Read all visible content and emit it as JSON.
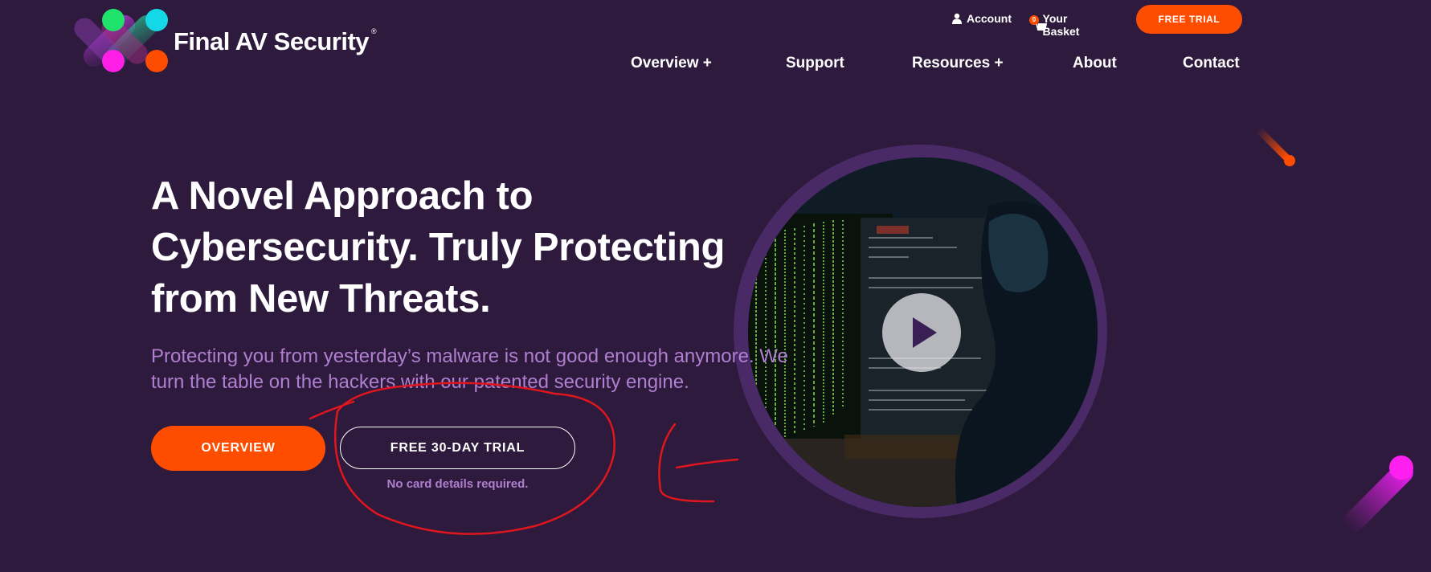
{
  "brand": {
    "name": "Final AV Security",
    "reg_mark": "®"
  },
  "utility": {
    "account_label": "Account",
    "basket_label": "Your Basket",
    "basket_count": "0",
    "cta_label": "FREE TRIAL"
  },
  "nav": {
    "items": [
      {
        "label": "Overview +"
      },
      {
        "label": "Support"
      },
      {
        "label": "Resources +"
      },
      {
        "label": "About"
      },
      {
        "label": "Contact"
      }
    ]
  },
  "hero": {
    "title_lines": [
      "A Novel Approach to",
      "Cybersecurity. Truly Protecting",
      "from New Threats."
    ],
    "subtitle_lines": [
      "Protecting you from yesterday’s malware is not good enough anymore. We",
      "turn the table on the hackers with our patented security engine."
    ],
    "primary_button": "OVERVIEW",
    "secondary_button": "FREE 30-DAY TRIAL",
    "note": "No card details required."
  },
  "video": {
    "play_icon": "play-icon"
  },
  "colors": {
    "background": "#2e1a3d",
    "accent": "#ff4d00",
    "subtitle": "#b07fd0",
    "ring": "#4a2a66",
    "annotation": "#e0161e"
  }
}
